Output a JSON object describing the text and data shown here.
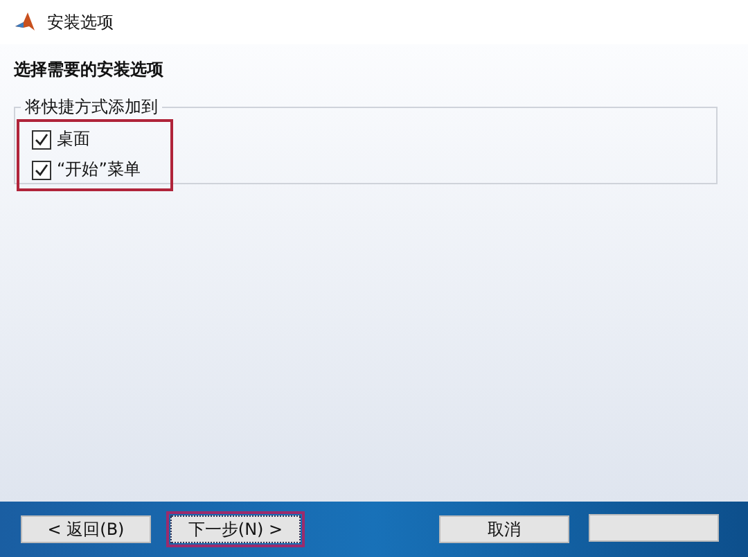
{
  "window": {
    "title": "安装选项"
  },
  "heading": "选择需要的安装选项",
  "shortcut_group": {
    "title": "将快捷方式添加到",
    "highlighted": true,
    "options": [
      {
        "label": "桌面",
        "checked": true
      },
      {
        "label": "“开始”菜单",
        "checked": true
      }
    ]
  },
  "buttons": [
    {
      "label": "< 返回(B)",
      "highlighted": false
    },
    {
      "label": "下一步(N) >",
      "highlighted": true
    },
    {
      "label": "取消",
      "highlighted": false
    },
    {
      "highlighted": false
    }
  ]
}
